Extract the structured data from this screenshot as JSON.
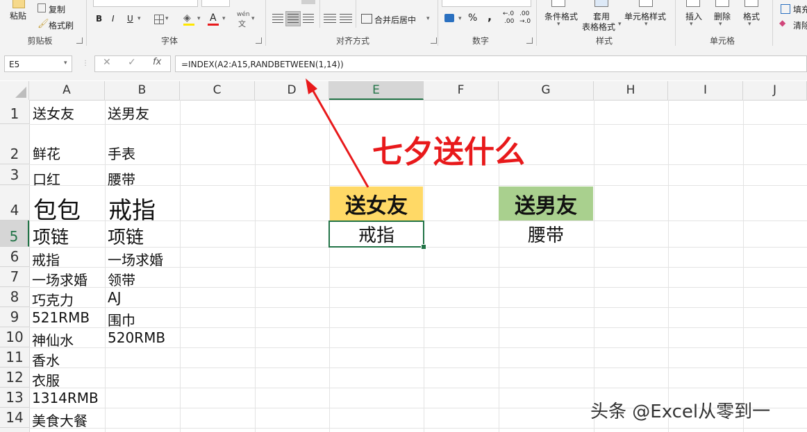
{
  "ribbon": {
    "clipboard": {
      "paste": "粘贴",
      "copy": "复制",
      "format_painter": "格式刷",
      "label": "剪贴板"
    },
    "font": {
      "bold": "B",
      "italic": "I",
      "underline": "U",
      "font_color": "A",
      "pinyin": "wén",
      "pinyin_char": "文",
      "label": "字体"
    },
    "alignment": {
      "merge_center": "合并后居中",
      "label": "对齐方式"
    },
    "number": {
      "percent": "%",
      "comma": ",",
      "dec_inc": "←.0",
      "dec_inc2": ".00",
      "dec_dec": ".00",
      "dec_dec2": "→.0",
      "label": "数字"
    },
    "styles": {
      "conditional": "条件格式",
      "table_format_1": "套用",
      "table_format_2": "表格格式",
      "cell_styles": "单元格样式",
      "label": "样式"
    },
    "cells": {
      "insert": "插入",
      "delete": "删除",
      "format": "格式",
      "label": "单元格"
    },
    "editing": {
      "fill": "填充",
      "clear": "清除"
    }
  },
  "formula_bar": {
    "name_box": "E5",
    "cancel": "✕",
    "enter": "✓",
    "fx": "fx",
    "formula": "=INDEX(A2:A15,RANDBETWEEN(1,14))"
  },
  "columns": [
    "A",
    "B",
    "C",
    "D",
    "E",
    "F",
    "G",
    "H",
    "I",
    "J"
  ],
  "rows": [
    "1",
    "2",
    "3",
    "4",
    "5",
    "6",
    "7",
    "8",
    "9",
    "10",
    "11",
    "12",
    "13",
    "14"
  ],
  "cells": {
    "A1": "送女友",
    "B1": "送男友",
    "A2": "鲜花",
    "B2": "手表",
    "A3": "口红",
    "B3": "腰带",
    "A4": "包包",
    "B4": "戒指",
    "A5": "项链",
    "B5": "项链",
    "A6": "戒指",
    "B6": "一场求婚",
    "A7": "一场求婚",
    "B7": "领带",
    "A8": "巧克力",
    "B8": "AJ",
    "A9": "521RMB",
    "B9": "围巾",
    "A10": "神仙水",
    "B10": "520RMB",
    "A11": "香水",
    "A12": "衣服",
    "A13": "1314RMB",
    "A14": "美食大餐"
  },
  "cards": {
    "girlfriend_header": "送女友",
    "girlfriend_result": "戒指",
    "boyfriend_header": "送男友",
    "boyfriend_result": "腰带"
  },
  "overlay": {
    "title": "七夕送什么",
    "watermark": "头条 @Excel从零到一"
  },
  "colors": {
    "girlfriend_fill": "#ffd966",
    "boyfriend_fill": "#a9d08e",
    "annotation_red": "#e8191b",
    "selection_green": "#217346"
  }
}
